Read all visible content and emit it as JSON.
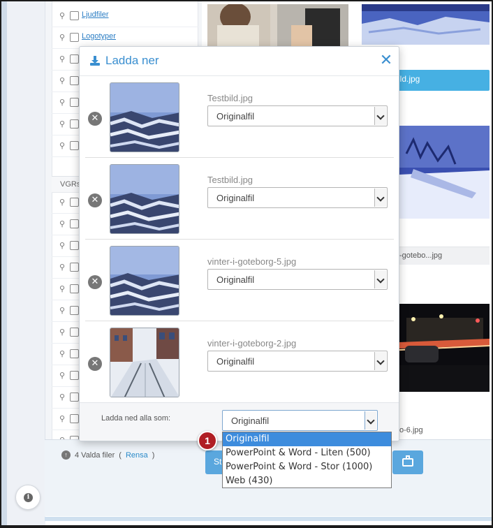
{
  "sidebar": {
    "items_top": [
      "Ljudfiler",
      "Logotyper"
    ],
    "group_label": "VGRs"
  },
  "gallery": {
    "tile_label_1": "ild.jpg",
    "tile_caption_2": "-gotebo...jpg",
    "tile_caption_3": "o-6.jpg"
  },
  "bottom_bar": {
    "selected_count": "4 Valda filer",
    "clear_open": "(",
    "clear_link": "Rensa",
    "clear_close": ")",
    "start_button_partial": "St"
  },
  "modal": {
    "title": "Ladda ner",
    "files": [
      {
        "name": "Testbild.jpg",
        "format": "Originalfil"
      },
      {
        "name": "Testbild.jpg",
        "format": "Originalfil"
      },
      {
        "name": "vinter-i-goteborg-5.jpg",
        "format": "Originalfil"
      },
      {
        "name": "vinter-i-goteborg-2.jpg",
        "format": "Originalfil"
      }
    ],
    "footer_label": "Ladda ned alla som:",
    "bulk_value": "Originalfil",
    "bulk_options": [
      "Originalfil",
      "PowerPoint & Word - Liten (500)",
      "PowerPoint & Word - Stor (1000)",
      "Web (430)"
    ]
  },
  "callout": {
    "step": "1"
  },
  "colors": {
    "accent": "#3a8fd0",
    "selected_option": "#3d8cdd",
    "step_badge": "#b01e24"
  },
  "icons": [
    "download-icon",
    "close-icon",
    "remove-icon",
    "location-pin-icon",
    "upload-icon",
    "info-icon",
    "briefcase-icon"
  ]
}
